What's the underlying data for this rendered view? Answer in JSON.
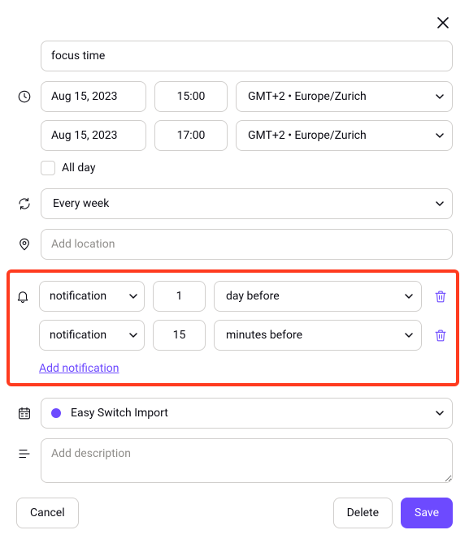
{
  "title": "focus time",
  "start": {
    "date": "Aug 15, 2023",
    "time": "15:00",
    "tz": "GMT+2 • Europe/Zurich"
  },
  "end": {
    "date": "Aug 15, 2023",
    "time": "17:00",
    "tz": "GMT+2 • Europe/Zurich"
  },
  "all_day_label": "All day",
  "recurrence": "Every week",
  "location_placeholder": "Add location",
  "notifications": [
    {
      "type": "notification",
      "num": "1",
      "unit": "day before"
    },
    {
      "type": "notification",
      "num": "15",
      "unit": "minutes before"
    }
  ],
  "add_notification_label": "Add notification",
  "calendar": {
    "name": "Easy Switch Import",
    "dot_color": "#6d4aff"
  },
  "description_placeholder": "Add description",
  "buttons": {
    "cancel": "Cancel",
    "delete": "Delete",
    "save": "Save"
  }
}
